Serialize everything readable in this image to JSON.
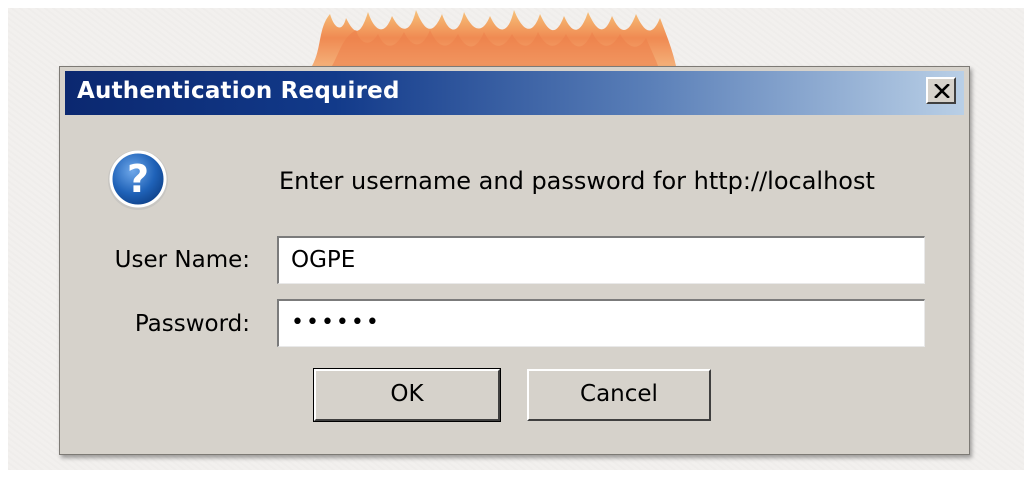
{
  "dialog": {
    "title": "Authentication Required",
    "message": "Enter username and password for http://localhost",
    "icon": "question-icon"
  },
  "form": {
    "username_label": "User Name:",
    "username_value": "OGPE",
    "password_label": "Password:",
    "password_mask": "••••••"
  },
  "buttons": {
    "ok_label": "OK",
    "cancel_label": "Cancel"
  },
  "colors": {
    "dialog_bg": "#d6d2cb",
    "titlebar_start": "#0b2870",
    "titlebar_end": "#b9cfe6",
    "icon_blue": "#1b5fb0"
  }
}
